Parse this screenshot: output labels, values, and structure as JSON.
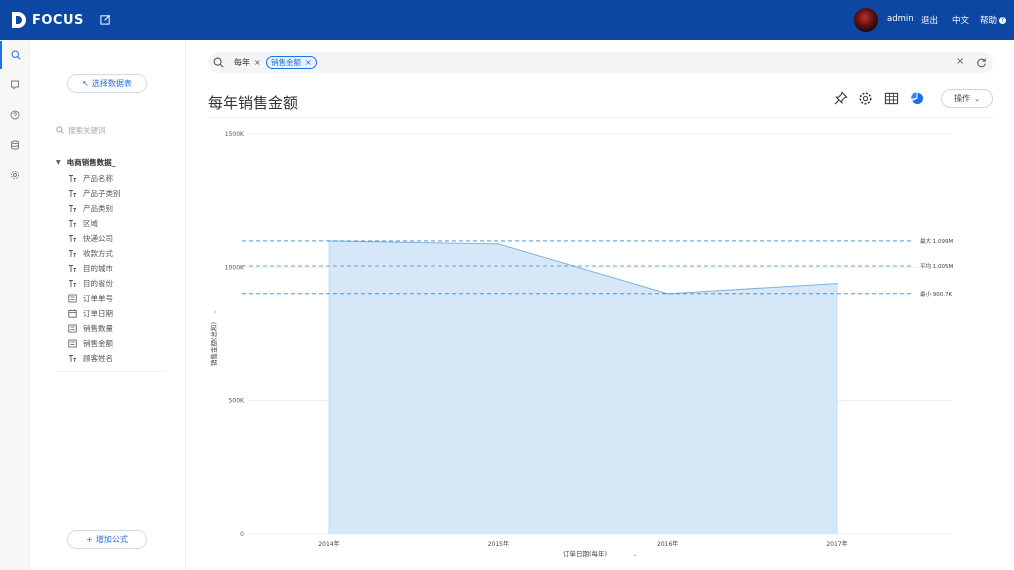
{
  "app": {
    "name": "FOCUS"
  },
  "header": {
    "user": "admin",
    "logout": "退出",
    "language": "中文",
    "help": "帮助"
  },
  "rail": {
    "icons": [
      "search-icon",
      "bookmark-icon",
      "help-icon",
      "database-icon",
      "settings-icon"
    ]
  },
  "side": {
    "select_table_label": "选择数据表",
    "search_placeholder": "搜索关键词",
    "table_name": "电商销售数据_",
    "fields": [
      {
        "label": "产品名称",
        "type": "text"
      },
      {
        "label": "产品子类别",
        "type": "text"
      },
      {
        "label": "产品类别",
        "type": "text"
      },
      {
        "label": "区域",
        "type": "text"
      },
      {
        "label": "快递公司",
        "type": "text"
      },
      {
        "label": "收款方式",
        "type": "text"
      },
      {
        "label": "目的城市",
        "type": "text"
      },
      {
        "label": "目的省份",
        "type": "text"
      },
      {
        "label": "订单单号",
        "type": "number"
      },
      {
        "label": "订单日期",
        "type": "date"
      },
      {
        "label": "销售数量",
        "type": "number"
      },
      {
        "label": "销售金额",
        "type": "number"
      },
      {
        "label": "顾客姓名",
        "type": "text"
      }
    ],
    "add_formula_label": "增加公式"
  },
  "search": {
    "tokens": [
      {
        "label": "每年",
        "style": "plain"
      },
      {
        "label": "销售金额",
        "style": "blue"
      }
    ]
  },
  "main": {
    "title": "每年销售金额",
    "operations_label": "操作"
  },
  "colors": {
    "topbar": "#0b47a3",
    "accent": "#1a73e8",
    "area_fill": "#d6e8f7",
    "area_line": "#7fb2de",
    "ref_line": "#3a86c8"
  },
  "chart_data": {
    "type": "area",
    "categories": [
      "2014年",
      "2015年",
      "2016年",
      "2017年"
    ],
    "values": [
      1099000,
      1088000,
      900700,
      939000
    ],
    "xlabel": "订单日期(每年)",
    "ylabel": "销售金额(总和)",
    "ylim": [
      0,
      1500000
    ],
    "yticks": [
      {
        "value": 0,
        "label": "0"
      },
      {
        "value": 500000,
        "label": "500K"
      },
      {
        "value": 1000000,
        "label": "1000K"
      },
      {
        "value": 1500000,
        "label": "1500K"
      }
    ],
    "reference_lines": [
      {
        "value": 1099000,
        "label": "最大 1.099M"
      },
      {
        "value": 1005000,
        "label": "平均 1.005M"
      },
      {
        "value": 900700,
        "label": "最小 900.7K"
      }
    ],
    "grid": true
  }
}
